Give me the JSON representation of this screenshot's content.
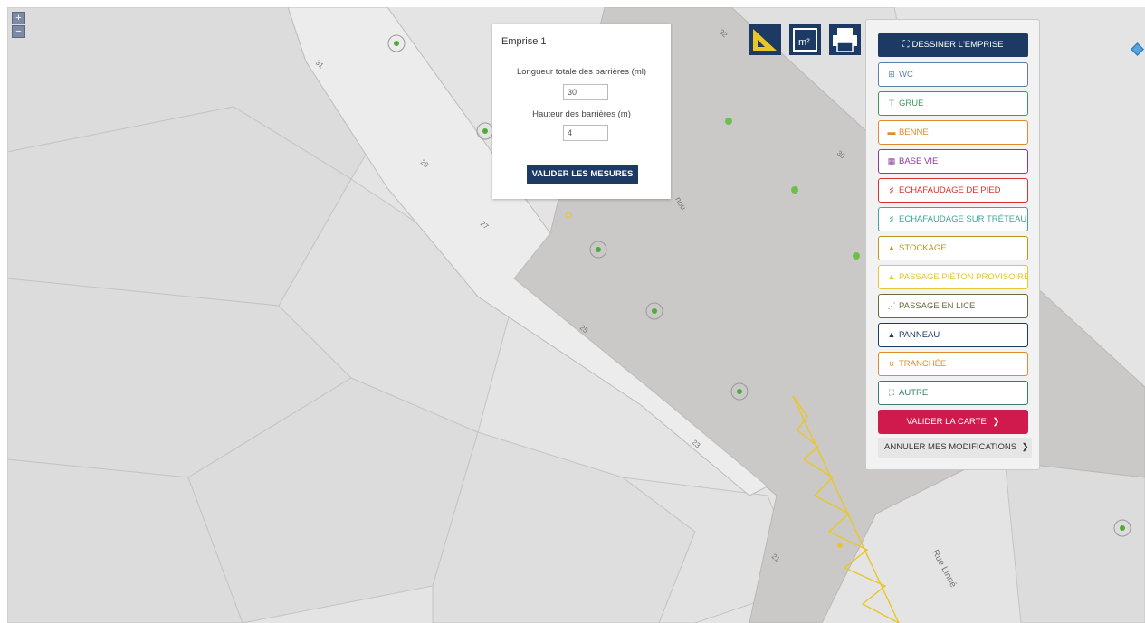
{
  "map": {
    "zoom_in": "+",
    "zoom_out": "−",
    "street_name": "Rue Linné",
    "street_fragment": "nou",
    "house_numbers": [
      "31",
      "29",
      "27",
      "25",
      "23",
      "21",
      "32",
      "30"
    ],
    "colors": {
      "background": "#e2e2e2",
      "parcel": "#d8d8d8",
      "road": "#c9c7c6",
      "sidewalk": "#ececec",
      "barrier": "#e8c62a",
      "tree": "#4faa3a"
    }
  },
  "toolbar": {
    "icons": [
      "ruler-icon",
      "area-measure-icon",
      "printer-icon"
    ],
    "area_label": "m²"
  },
  "popup": {
    "title": "Emprise 1",
    "length_label": "Longueur totale des barrières (ml)",
    "length_value": "30",
    "height_label": "Hauteur des barrières (m)",
    "height_value": "4",
    "validate_label": "VALIDER LES MESURES"
  },
  "panel": {
    "draw_icon": "crosshair-icon",
    "draw_label": "DESSINER L'EMPRISE",
    "items": [
      {
        "label": "WC",
        "icon": "⊞",
        "icon_name": "wc-icon",
        "color": "#5b7fa6"
      },
      {
        "label": "GRUE",
        "icon": "⊤",
        "icon_name": "crane-icon",
        "color": "#3a9a5c"
      },
      {
        "label": "BENNE",
        "icon": "▬",
        "icon_name": "dumpster-icon",
        "color": "#e38a2c"
      },
      {
        "label": "BASE VIE",
        "icon": "▦",
        "icon_name": "site-base-icon",
        "color": "#8a3a9a"
      },
      {
        "label": "ECHAFAUDAGE DE PIED",
        "icon": "♯",
        "icon_name": "scaffolding-icon",
        "color": "#d9342b"
      },
      {
        "label": "ECHAFAUDAGE SUR TRÉTEAU",
        "icon": "♯",
        "icon_name": "trestle-scaffolding-icon",
        "color": "#3aa79a"
      },
      {
        "label": "STOCKAGE",
        "icon": "▲",
        "icon_name": "storage-icon",
        "color": "#b79a1c"
      },
      {
        "label": "PASSAGE PIÉTON PROVISOIRE",
        "icon": "▲",
        "icon_name": "pedestrian-passage-icon",
        "color": "#e8c62a"
      },
      {
        "label": "PASSAGE EN LICE",
        "icon": "⋰",
        "icon_name": "lice-passage-icon",
        "color": "#6b6b3a"
      },
      {
        "label": "PANNEAU",
        "icon": "▲",
        "icon_name": "sign-panel-icon",
        "color": "#1c3a64"
      },
      {
        "label": "TRANCHÉE",
        "icon": "∪",
        "icon_name": "trench-icon",
        "color": "#e38a2c"
      },
      {
        "label": "AUTRE",
        "icon": "⛶",
        "icon_name": "other-icon",
        "color": "#3a7a6a"
      }
    ],
    "validate_map_label": "VALIDER LA CARTE",
    "validate_arrow": "❯",
    "cancel_label": "ANNULER MES MODIFICATIONS",
    "cancel_arrow": "❯"
  },
  "layers": {
    "icon": "layers-icon"
  }
}
